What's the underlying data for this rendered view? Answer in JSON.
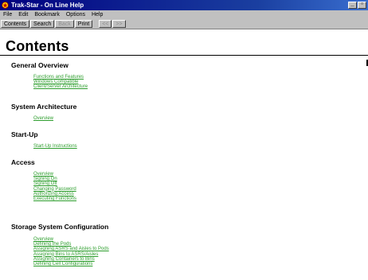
{
  "window": {
    "title": "Trak-Star - On Line Help",
    "minimize_glyph": "_",
    "maximize_glyph": "▫"
  },
  "menu": [
    "File",
    "Edit",
    "Bookmark",
    "Options",
    "Help"
  ],
  "toolbar": {
    "buttons": [
      {
        "label": "Contents",
        "enabled": true
      },
      {
        "label": "Search",
        "enabled": true
      },
      {
        "label": "Back",
        "enabled": false
      },
      {
        "label": "Print",
        "enabled": true
      },
      {
        "label": "<<",
        "enabled": false
      },
      {
        "label": ">>",
        "enabled": false
      }
    ]
  },
  "content": {
    "title": "Contents",
    "sections": [
      {
        "heading": "General Overview",
        "links": [
          "Functions and Features",
          "Windows Compatible",
          "Client/Server Architecture"
        ]
      },
      {
        "heading": "System Architecture",
        "links": [
          "Overview"
        ]
      },
      {
        "heading": "Start-Up",
        "links": [
          "Start-Up Instructions"
        ]
      },
      {
        "heading": "Access",
        "links": [
          "Overview",
          "Signing On",
          "Signing Off",
          "Changing Password",
          "Authorizing Access",
          "Executing Functions"
        ]
      },
      {
        "heading": "Storage System Configuration",
        "links": [
          "Overview",
          "Defining the Pods",
          "Assigning ASRS and Aisles to Pods",
          "Assigning Bins to ASRS/Aisles",
          "Assigning Containers to Bins",
          "Defining Cell Configurations"
        ]
      }
    ]
  },
  "colors": {
    "titlebar": "#000080",
    "link": "#2e9e2e",
    "chrome": "#c0c0c0"
  }
}
